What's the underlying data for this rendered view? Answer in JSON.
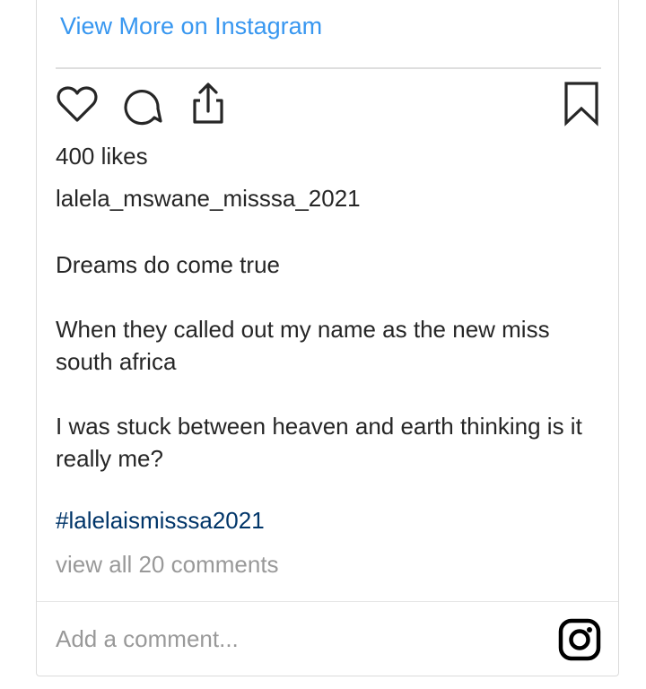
{
  "header": {
    "view_more_label": "View More on Instagram"
  },
  "actions": {
    "like_icon": "heart-icon",
    "comment_icon": "comment-bubble-icon",
    "share_icon": "share-upload-icon",
    "save_icon": "bookmark-icon"
  },
  "post": {
    "likes": "400 likes",
    "username": "lalela_mswane_misssa_2021",
    "caption_lines": [
      "Dreams do come true",
      "When they called out my name as the new miss south africa",
      "I was stuck between heaven and earth thinking is it really me?"
    ],
    "hashtag": "#lalelaismisssa2021",
    "view_comments": "view all 20 comments"
  },
  "comment_box": {
    "placeholder": "Add a comment...",
    "logo_icon": "instagram-logo-icon"
  },
  "colors": {
    "link_blue": "#3897f0",
    "hashtag_blue": "#003569",
    "text": "#262626",
    "muted": "#999999",
    "border": "#dbdbdb"
  }
}
